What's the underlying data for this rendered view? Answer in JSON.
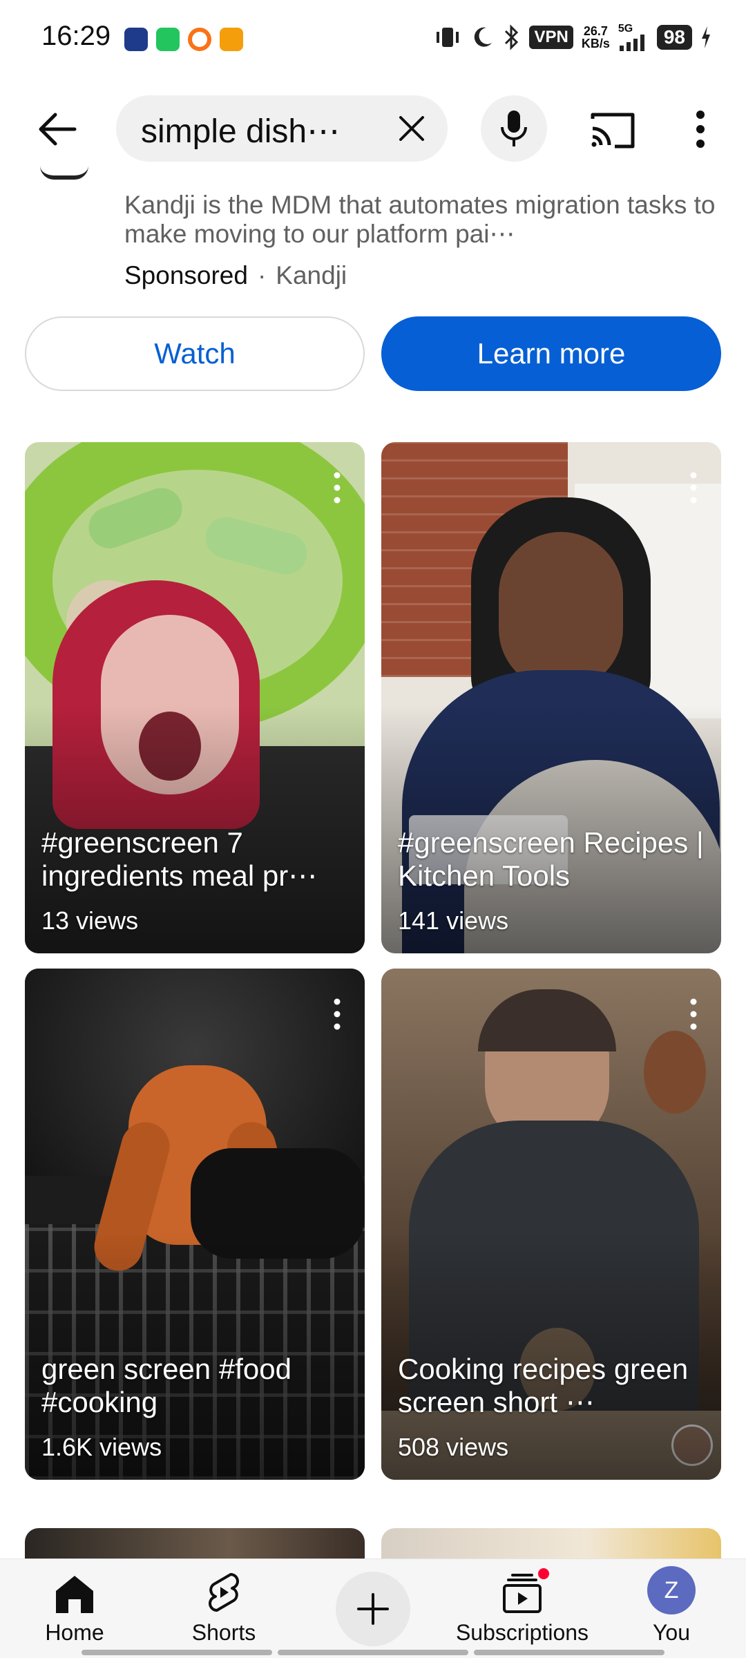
{
  "status_bar": {
    "time": "16:29",
    "vpn": "VPN",
    "net_speed_value": "26.7",
    "net_speed_unit": "KB/s",
    "network": "5G",
    "battery": "98"
  },
  "search": {
    "query": "simple dish⋯",
    "back_icon": "arrow-left-icon",
    "clear_icon": "close-icon",
    "mic_icon": "microphone-icon",
    "cast_icon": "cast-icon",
    "more_icon": "more-vert-icon"
  },
  "ad": {
    "description": "Kandji is the MDM that automates migration tasks to make moving to our platform pai⋯",
    "sponsored": "Sponsored",
    "separator": "·",
    "advertiser": "Kandji",
    "watch_label": "Watch",
    "learn_more_label": "Learn more"
  },
  "shorts": [
    {
      "title": "#greenscreen 7 ingredients meal pr⋯",
      "views": "13 views"
    },
    {
      "title": "#greenscreen Recipes | Kitchen Tools",
      "views": "141 views"
    },
    {
      "title": "green screen #food #cooking",
      "views": "1.6K views"
    },
    {
      "title": "Cooking recipes green screen short ⋯",
      "views": "508 views"
    }
  ],
  "bottom_nav": {
    "home": "Home",
    "shorts": "Shorts",
    "subscriptions": "Subscriptions",
    "you": "You",
    "you_initial": "Z"
  },
  "colors": {
    "accent_blue": "#065fd4",
    "notification_red": "#ff0033",
    "avatar": "#5c6bc0"
  }
}
